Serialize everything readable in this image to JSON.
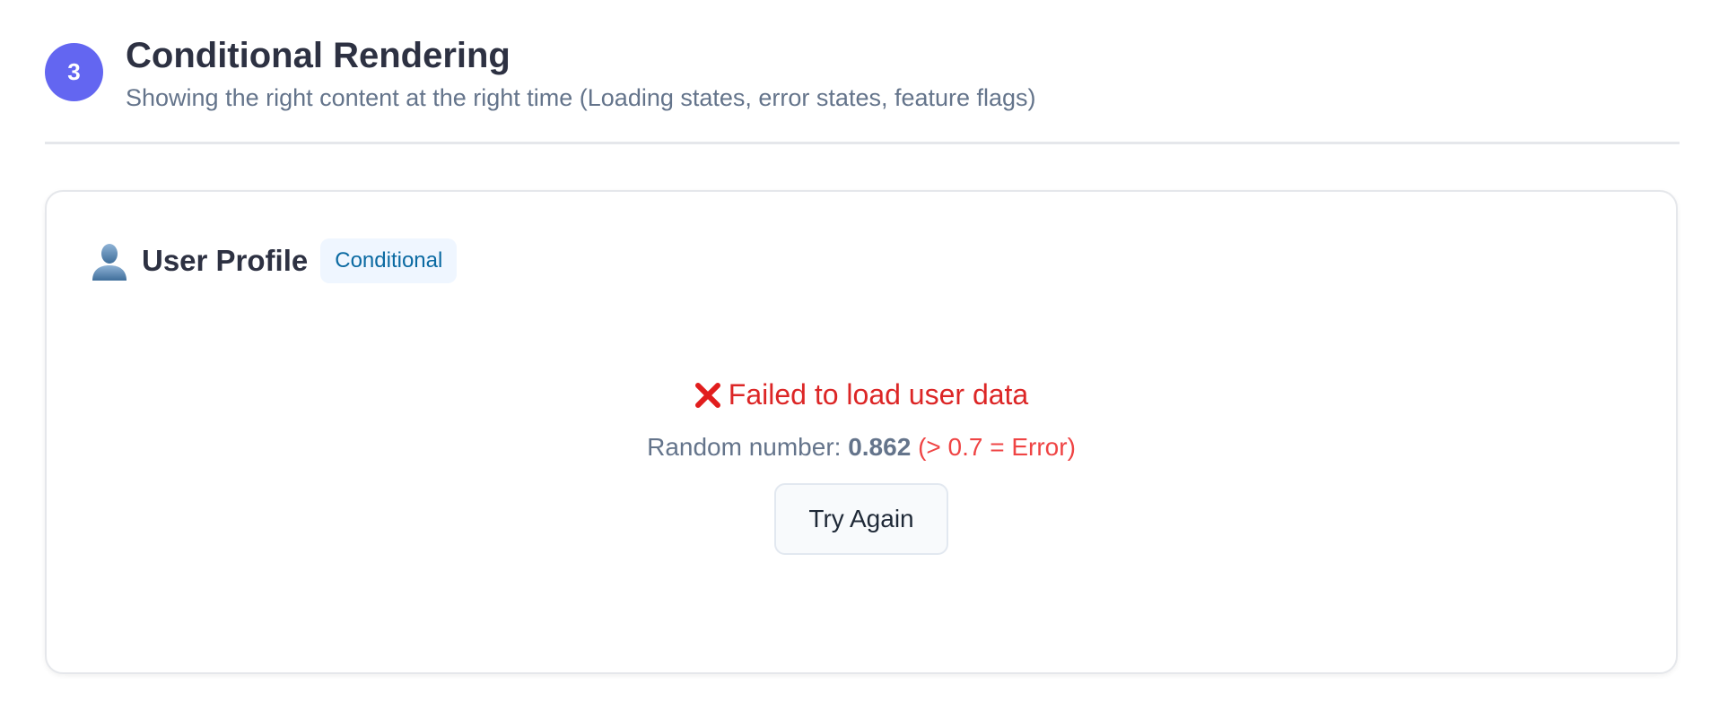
{
  "section": {
    "step_number": "3",
    "title": "Conditional Rendering",
    "subtitle": "Showing the right content at the right time (Loading states, error states, feature flags)"
  },
  "card": {
    "icon": "user-silhouette-icon",
    "title": "User Profile",
    "tag": "Conditional",
    "error": {
      "icon": "red-x-icon",
      "message": "Failed to load user data"
    },
    "random": {
      "label": "Random number: ",
      "value": "0.862",
      "note": "(> 0.7 = Error)"
    },
    "retry_button_label": "Try Again"
  },
  "colors": {
    "accent": "#6366f1",
    "error": "#dc2626",
    "tag_text": "#0b6aa2",
    "tag_bg": "#eff6ff"
  }
}
